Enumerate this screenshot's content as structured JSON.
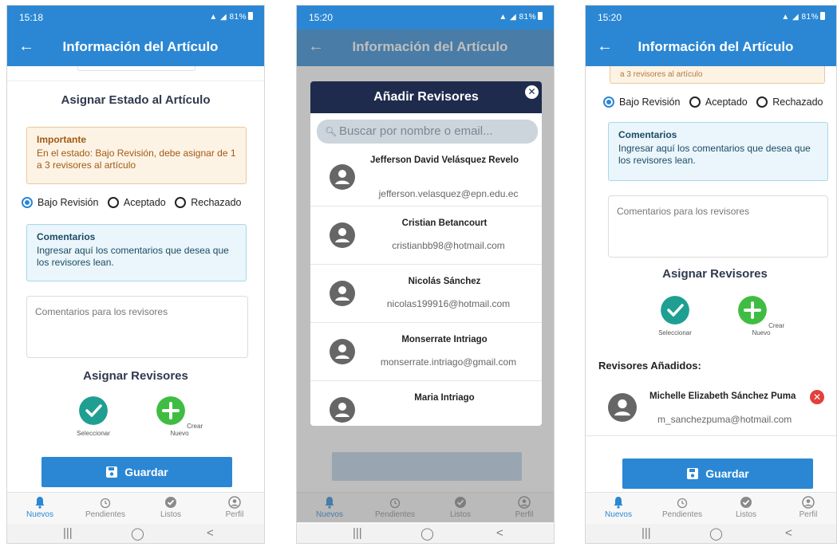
{
  "colors": {
    "primary": "#2b87d3",
    "modal_header": "#1e2b4d",
    "select_green": "#1f9f91",
    "create_green": "#3fbd42",
    "remove_red": "#e2403b"
  },
  "common": {
    "app_title": "Información del Artículo",
    "battery": "81%",
    "nav": [
      {
        "label": "Nuevos",
        "icon": "bell-icon"
      },
      {
        "label": "Pendientes",
        "icon": "alarm-clock-icon"
      },
      {
        "label": "Listos",
        "icon": "check-circle-icon"
      },
      {
        "label": "Perfil",
        "icon": "user-icon"
      }
    ],
    "system_nav": {
      "recents": "|||",
      "home": "◯",
      "back": "<"
    }
  },
  "screen1": {
    "time": "15:18",
    "section_title": "Asignar Estado al Artículo",
    "warning": {
      "title": "Importante",
      "text": "En el estado: Bajo Revisión, debe asignar de 1 a 3 revisores al artículo"
    },
    "radios": [
      {
        "label": "Bajo Revisión",
        "selected": true
      },
      {
        "label": "Aceptado",
        "selected": false
      },
      {
        "label": "Rechazado",
        "selected": false
      }
    ],
    "comments_info": {
      "title": "Comentarios",
      "text": "Ingresar aquí los comentarios que desea que los revisores lean."
    },
    "comments_placeholder": "Comentarios para los revisores",
    "assign_title": "Asignar Revisores",
    "select_label": "Seleccionar",
    "create_label": "Crear Nuevo",
    "save_label": "Guardar"
  },
  "screen2": {
    "time": "15:20",
    "modal_title": "Añadir Revisores",
    "search_placeholder": "Buscar por nombre o email...",
    "reviewers": [
      {
        "name": "Jefferson David  Velásquez Revelo",
        "email": "jefferson.velasquez@epn.edu.ec"
      },
      {
        "name": "Cristian Betancourt",
        "email": "cristianbb98@hotmail.com"
      },
      {
        "name": "Nicolás Sánchez",
        "email": "nicolas199916@hotmail.com"
      },
      {
        "name": "Monserrate Intriago",
        "email": "monserrate.intriago@gmail.com"
      },
      {
        "name": "Maria Intriago",
        "email": ""
      }
    ]
  },
  "screen3": {
    "time": "15:20",
    "cut_text": "a 3 revisores al artículo",
    "radios": [
      {
        "label": "Bajo Revisión",
        "selected": true
      },
      {
        "label": "Aceptado",
        "selected": false
      },
      {
        "label": "Rechazado",
        "selected": false
      }
    ],
    "comments_info": {
      "title": "Comentarios",
      "text": "Ingresar aquí los comentarios que desea que los revisores lean."
    },
    "comments_placeholder": "Comentarios para los revisores",
    "assign_title": "Asignar Revisores",
    "select_label": "Seleccionar",
    "create_label": "Crear Nuevo",
    "added_title": "Revisores Añadidos:",
    "added_reviewer": {
      "name": "Michelle Elizabeth Sánchez Puma",
      "email": "m_sanchezpuma@hotmail.com"
    },
    "save_label": "Guardar"
  }
}
